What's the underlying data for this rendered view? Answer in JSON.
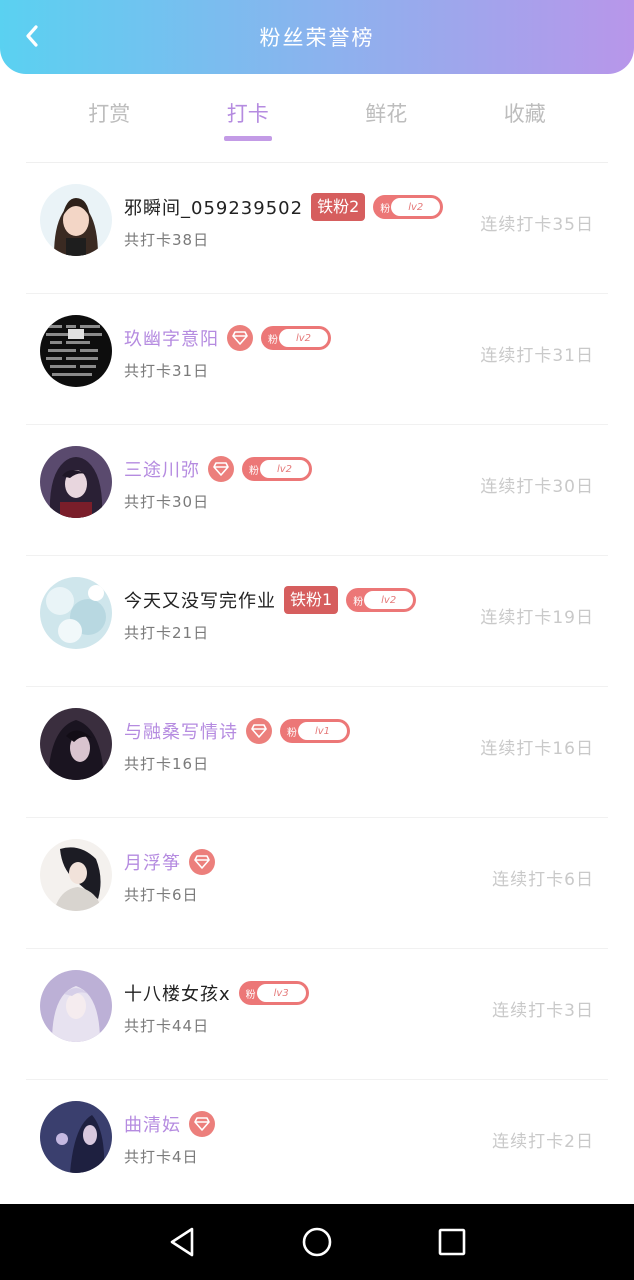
{
  "header": {
    "title": "粉丝荣誉榜",
    "back_icon": "chevron-left-icon"
  },
  "tabs": [
    {
      "label": "打赏",
      "active": false
    },
    {
      "label": "打卡",
      "active": true
    },
    {
      "label": "鲜花",
      "active": false
    },
    {
      "label": "收藏",
      "active": false
    }
  ],
  "colors": {
    "header_gradient_start": "#5ad1f1",
    "header_gradient_end": "#b896ea",
    "accent_purple": "#b58be0",
    "badge_red": "#d65e5e",
    "pill_red": "#ec7777"
  },
  "fans": [
    {
      "name": "邪瞬间_059239502",
      "name_purple": false,
      "iron_badge": "铁粉2",
      "diamond": false,
      "fan_label": "粉",
      "level": "lv2",
      "total": "共打卡38日",
      "streak": "连续打卡35日"
    },
    {
      "name": "玖幽字意阳",
      "name_purple": true,
      "iron_badge": "",
      "diamond": true,
      "fan_label": "粉",
      "level": "lv2",
      "total": "共打卡31日",
      "streak": "连续打卡31日"
    },
    {
      "name": "三途川弥",
      "name_purple": true,
      "iron_badge": "",
      "diamond": true,
      "fan_label": "粉",
      "level": "lv2",
      "total": "共打卡30日",
      "streak": "连续打卡30日"
    },
    {
      "name": "今天又没写完作业",
      "name_purple": false,
      "iron_badge": "铁粉1",
      "diamond": false,
      "fan_label": "粉",
      "level": "lv2",
      "total": "共打卡21日",
      "streak": "连续打卡19日"
    },
    {
      "name": "与融桑写情诗",
      "name_purple": true,
      "iron_badge": "",
      "diamond": true,
      "fan_label": "粉",
      "level": "lv1",
      "total": "共打卡16日",
      "streak": "连续打卡16日"
    },
    {
      "name": "月浮筝",
      "name_purple": true,
      "iron_badge": "",
      "diamond": true,
      "fan_label": "",
      "level": "",
      "total": "共打卡6日",
      "streak": "连续打卡6日"
    },
    {
      "name": "十八楼女孩x",
      "name_purple": false,
      "iron_badge": "",
      "diamond": false,
      "fan_label": "粉",
      "level": "lv3",
      "total": "共打卡44日",
      "streak": "连续打卡3日"
    },
    {
      "name": "曲清妘",
      "name_purple": true,
      "iron_badge": "",
      "diamond": true,
      "fan_label": "",
      "level": "",
      "total": "共打卡4日",
      "streak": "连续打卡2日"
    }
  ],
  "navbar": {
    "back": "triangle-back-icon",
    "home": "circle-home-icon",
    "recents": "square-recents-icon"
  }
}
